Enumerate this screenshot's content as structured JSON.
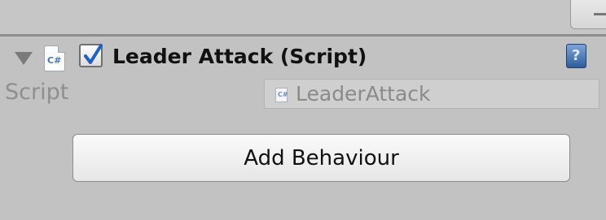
{
  "component": {
    "title": "Leader Attack (Script)",
    "enabled": true,
    "file_icon_label": "C#"
  },
  "help_icon_label": "?",
  "field": {
    "label": "Script",
    "value": "LeaderAttack"
  },
  "add_button_label": "Add Behaviour",
  "icons": {
    "collapse": "triangle-down-icon",
    "script": "csharp-script-icon",
    "checkbox": "check-icon",
    "help": "help-book-icon",
    "window_menu": "minus-icon"
  },
  "colors": {
    "panel_bg": "#c2c2c2",
    "separator": "#8c8c8c",
    "label_gray": "#8f8f8f",
    "check_blue": "#1f5fc8",
    "help_blue": "#2e5d9e"
  }
}
